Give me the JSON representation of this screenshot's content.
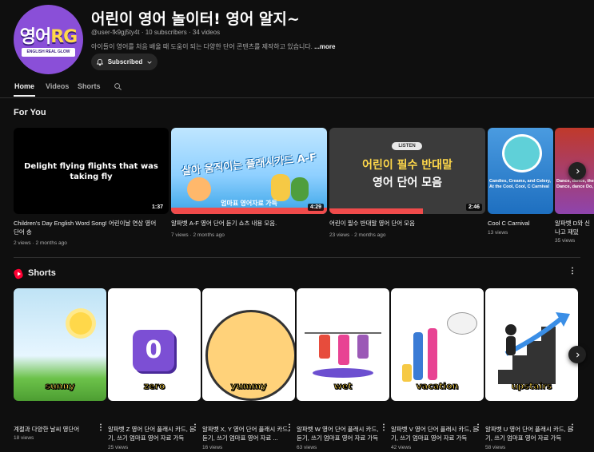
{
  "channel": {
    "avatar_text": "영어RG",
    "avatar_sub": "ENGLISH REAL GLOW",
    "title": "어린이 영어 놀이터! 영어 알지~",
    "handle": "@user-fk9gj5ty4t",
    "subscribers": "10 subscribers",
    "videos_count": "34 videos",
    "description": "아이들이 영어를 처음 배울 때 도움이 되는 다양한 단어 콘텐츠를 제작하고 있습니다.",
    "more": "...more",
    "subscribed_label": "Subscribed"
  },
  "tabs": [
    "Home",
    "Videos",
    "Shorts"
  ],
  "for_you": {
    "title": "For You",
    "videos": [
      {
        "thumb_text": "Delight flying flights that was taking fly",
        "duration": "1:37",
        "title": "Children's Day English Word Song! 어린이날 연상 영어 단어 송",
        "views": "2 views",
        "age": "2 months ago"
      },
      {
        "thumb_text": "살아 움직이는 플래시카드 A-F",
        "thumb_sub": "엄마표 영어자료 가득",
        "duration": "4:29",
        "title": "알파벳 A-F 영어 단어 듣기 쇼츠 내용 모음.",
        "views": "7 views",
        "age": "2 months ago"
      },
      {
        "thumb_badge": "LISTEN",
        "thumb_text": "어린이 필수 반대말",
        "thumb_text2": "영어 단어 모음",
        "duration": "2:46",
        "title": "어린이 필수 반대말 영어 단어 모음",
        "views": "23 views",
        "age": "2 months ago"
      },
      {
        "thumb_text": "Candies, Creams, and Celery, At the Cool, Cool, C Carnival",
        "title": "Cool C Carnival",
        "views": "13 views",
        "age": ""
      },
      {
        "thumb_text": "Dance, dance, the bright Dance, dance Do, do, do,",
        "title": "알파벳 D와 신나고 재밌",
        "views": "35 views",
        "age": ""
      }
    ]
  },
  "shorts": {
    "title": "Shorts",
    "items": [
      {
        "word": "sunny",
        "title": "계절과 다양한 날씨 영단어",
        "views": "18 views",
        "bg": "#bfe3f5"
      },
      {
        "word": "zero",
        "title": "알파벳 Z 영어 단어 플래시 카드, 듣기, 쓰기 엄마표 영어 자료 가득",
        "views": "25 views",
        "bg": "#ffffff"
      },
      {
        "word": "yummy",
        "title": "알파벳 X, Y 영어 단어 플래시 카드, 듣기, 쓰기 엄마표 영어 자료 ...",
        "views": "16 views",
        "bg": "#ffffff"
      },
      {
        "word": "wet",
        "title": "알파벳 W 영어 단어 플래시 카드, 듣기, 쓰기 엄마표 영어 자료 가득",
        "views": "63 views",
        "bg": "#ffffff"
      },
      {
        "word": "vacation",
        "title": "알파벳 V 영어 단어 플래시 카드, 듣기, 쓰기 엄마표 영어 자료 가득",
        "views": "42 views",
        "bg": "#ffffff"
      },
      {
        "word": "upstairs",
        "title": "알파벳 U 영어 단어 플래시 카드, 듣기, 쓰기 엄마표 영어 자료 가득",
        "views": "58 views",
        "bg": "#ffffff"
      }
    ]
  },
  "icons": {
    "bell": "bell-icon",
    "chevron": "chevron-down-icon",
    "search": "search-icon",
    "next": "chevron-right-icon",
    "shorts": "shorts-logo-icon",
    "more": "vertical-dots-icon"
  },
  "colors": {
    "background": "#0f0f0f",
    "text": "#f1f1f1",
    "secondary": "#aaaaaa",
    "shorts_red": "#ff0033",
    "avatar": "#8a4fd8"
  }
}
